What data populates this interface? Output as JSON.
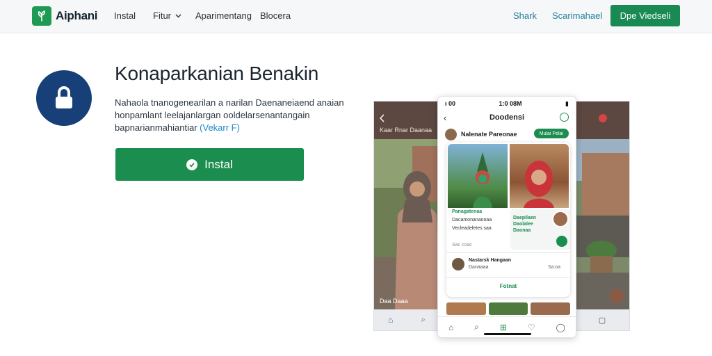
{
  "nav": {
    "logo_text": "Aiphani",
    "links": [
      "Instal",
      "Fitur",
      "Aparimentang",
      "Blocera"
    ],
    "right_links": [
      "Shark",
      "Scarimahael"
    ],
    "cta_label": "Dpe Viedseli"
  },
  "hero": {
    "title": "Konaparkanian Benakin",
    "desc_line1": "Nahaola tnanogenearilan a narilan Daenaneiaend anaian",
    "desc_line2": "honpamlant leelajanlargan ooldelarsenantangain",
    "desc_line3": "bapnarianmahiantiar",
    "desc_link": "(Vekarr F)",
    "install_label": "Instal"
  },
  "phone": {
    "status_time": "1:0 08M",
    "status_left": "ı 00",
    "screen_title": "Doodensi",
    "author_name": "Nalenate Pareonae",
    "pill_label": "Mulai Pelai",
    "card_tag": "Panagatenaa",
    "card_line1": "Dacamonanaonaa",
    "card_line2": "Vecleadeletes saa",
    "card_meta": "Sac coac",
    "mini_text": "Daepilaen Daolalee Daonaa",
    "comment_name": "Nastarsk Hangaan",
    "comment_sub": "Danaaaa",
    "comment_meta": "5a:oa",
    "follow_label": "Fotnat"
  },
  "side_shots": {
    "left_label": "Kaar Rnar Daanaa",
    "left_bottom": "Daa Daaa"
  },
  "colors": {
    "brand_green": "#1a8d4f",
    "icon_navy": "#173f78",
    "link_blue": "#1a86c8"
  }
}
